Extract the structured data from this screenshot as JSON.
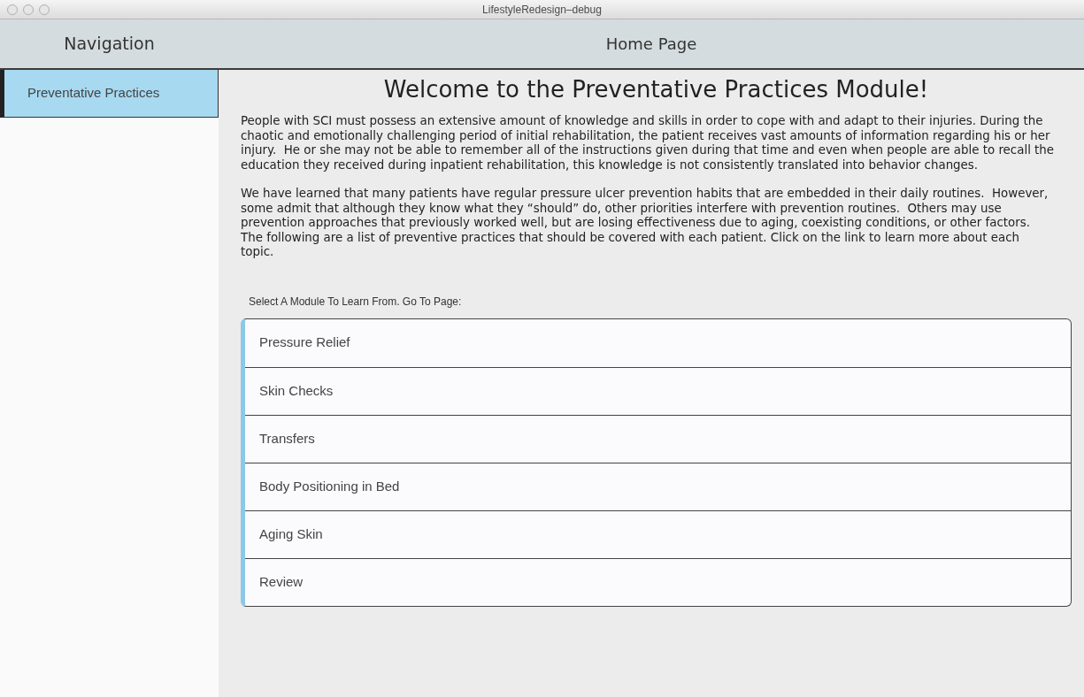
{
  "window": {
    "title": "LifestyleRedesign–debug"
  },
  "navigation": {
    "title": "Navigation",
    "items": [
      {
        "label": "Preventative Practices",
        "selected": true
      }
    ]
  },
  "page": {
    "title": "Home Page",
    "heading": "Welcome to the Preventative Practices Module!",
    "paragraphs": [
      "People with SCI must possess an extensive amount of knowledge and skills in order to cope with and adapt to their injuries. During the chaotic and emotionally challenging period of initial rehabilitation, the patient receives vast amounts of information regarding his or her injury.  He or she may not be able to remember all of the instructions given during that time and even when people are able to recall the education they received during inpatient rehabilitation, this knowledge is not consistently translated into behavior changes.",
      "We have learned that many patients have regular pressure ulcer prevention habits that are embedded in their daily routines.  However, some admit that although they know what they “should” do, other priorities interfere with prevention routines.  Others may use prevention approaches that previously worked well, but are losing effectiveness due to aging, coexisting conditions, or other factors. The following are a list of preventive practices that should be covered with each patient. Click on the link to learn more about each topic."
    ],
    "module_prompt": "Select A Module To Learn From. Go To Page:",
    "modules": [
      "Pressure Relief",
      "Skin Checks",
      "Transfers",
      "Body Positioning in Bed",
      "Aging Skin",
      "Review"
    ]
  }
}
